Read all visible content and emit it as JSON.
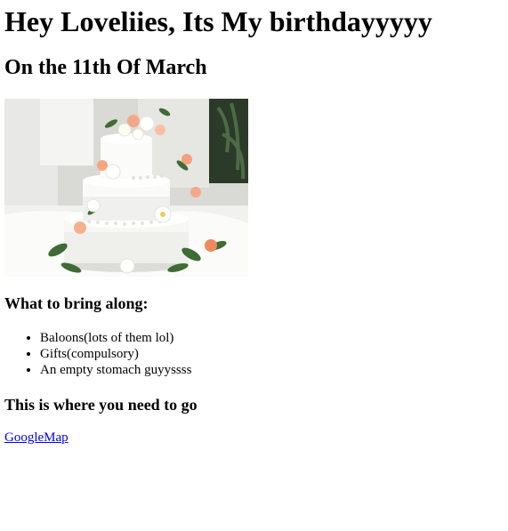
{
  "header": {
    "title": "Hey Loveliies, Its My birthdayyyyy",
    "subtitle": "On the 11th Of March"
  },
  "image": {
    "icon": "wedding-cake-photo"
  },
  "bring_section": {
    "heading": "What to bring along:",
    "items": [
      "Baloons(lots of them lol)",
      "Gifts(compulsory)",
      "An empty stomach guyyssss"
    ]
  },
  "location_section": {
    "heading": "This is where you need to go",
    "link_label": "GoogleMap"
  },
  "colors": {
    "link": "#0000ee",
    "text": "#000000",
    "background": "#ffffff"
  }
}
